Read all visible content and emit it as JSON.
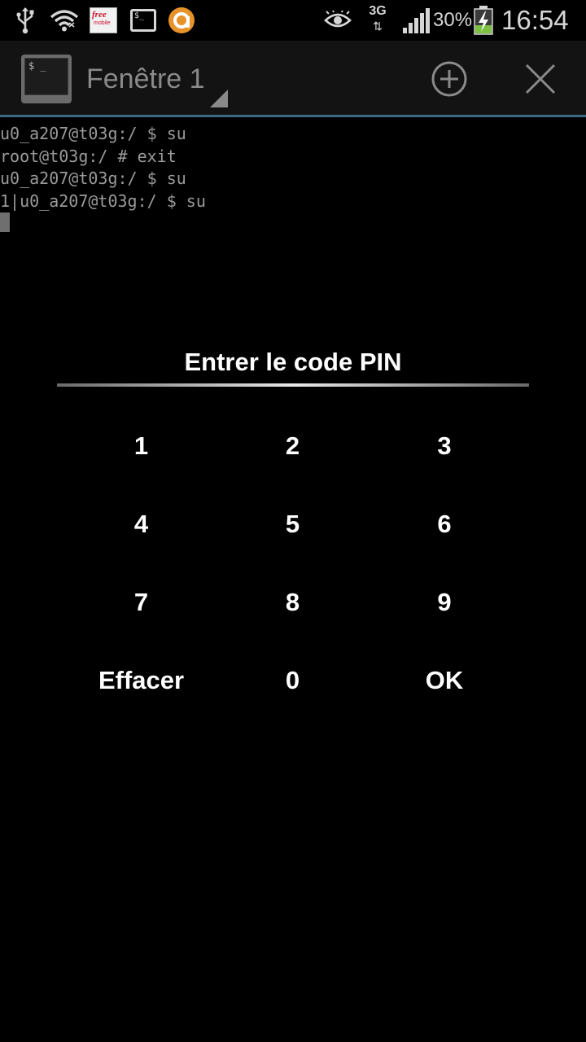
{
  "status_bar": {
    "icons": [
      "usb-icon",
      "wifi-icon",
      "free-mobile-icon",
      "terminal-notification-icon",
      "orange-a-icon",
      "eye-icon",
      "signal-icon",
      "battery-charging-icon"
    ],
    "network_type": "3G",
    "network_arrows": "⇅",
    "battery_percent": "30%",
    "time": "16:54",
    "free_label": "free",
    "mobile_label": "mobile",
    "term_glyph": "$_",
    "accent_orange": "#e8922a",
    "battery_green": "#7cc142"
  },
  "action_bar": {
    "app_icon_glyph": "$ _",
    "window_title": "Fenêtre 1",
    "new_window_icon": "plus-circle-icon",
    "close_window_icon": "close-icon",
    "divider_color": "#3c6a85"
  },
  "terminal": {
    "lines": [
      "u0_a207@t03g:/ $ su",
      "root@t03g:/ # exit",
      "u0_a207@t03g:/ $ su",
      "1|u0_a207@t03g:/ $ su"
    ]
  },
  "pin_dialog": {
    "title": "Entrer le code PIN",
    "keys": [
      "1",
      "2",
      "3",
      "4",
      "5",
      "6",
      "7",
      "8",
      "9",
      "Effacer",
      "0",
      "OK"
    ]
  }
}
